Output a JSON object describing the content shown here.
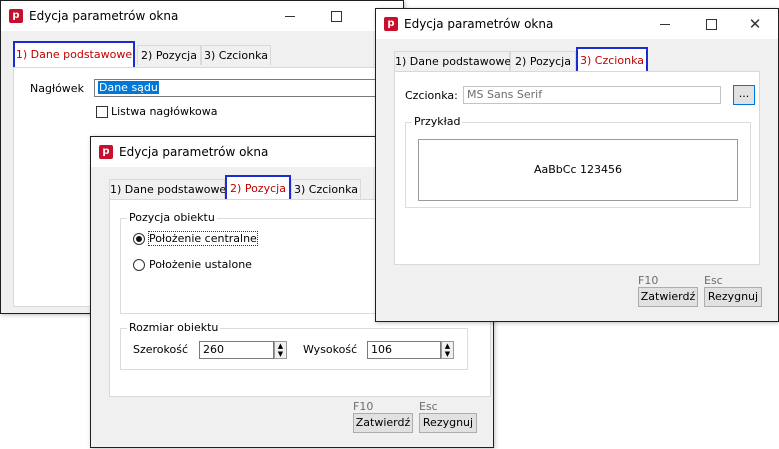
{
  "window1": {
    "title": "Edycja parametrów okna",
    "tabs": [
      "1) Dane podstawowe",
      "2) Pozycja",
      "3) Czcionka"
    ],
    "header_label": "Nagłówek",
    "header_value": "Dane sądu",
    "checkbox_label": "Listwa nagłówkowa"
  },
  "window2": {
    "title": "Edycja parametrów okna",
    "tabs": [
      "1) Dane podstawowe",
      "2) Pozycja",
      "3) Czcionka"
    ],
    "position_group": "Pozycja obiektu",
    "radio_center": "Położenie centralne",
    "radio_fixed": "Położenie ustalone",
    "size_group": "Rozmiar obiektu",
    "width_label": "Szerokość",
    "width_value": "260",
    "height_label": "Wysokość",
    "height_value": "106",
    "f10_label": "F10",
    "esc_label": "Esc",
    "confirm_button": "Zatwierdź",
    "cancel_button": "Rezygnuj"
  },
  "window3": {
    "title": "Edycja parametrów okna",
    "tabs": [
      "1) Dane podstawowe",
      "2) Pozycja",
      "3) Czcionka"
    ],
    "font_label": "Czcionka:",
    "font_value": "MS Sans Serif",
    "browse_button": "...",
    "preview_group": "Przykład",
    "preview_text": "AaBbCc 123456",
    "f10_label": "F10",
    "esc_label": "Esc",
    "confirm_button": "Zatwierdź",
    "cancel_button": "Rezygnuj"
  },
  "colors": {
    "accent": "#1c2cd0",
    "active_tab_text": "#c00000",
    "app_icon": "#c8102e",
    "selection": "#0078d7"
  },
  "icons": {
    "app": "app-logo-icon",
    "minimize": "minimize-icon",
    "maximize": "maximize-icon",
    "close": "close-icon"
  },
  "app_icon_letter": "p"
}
